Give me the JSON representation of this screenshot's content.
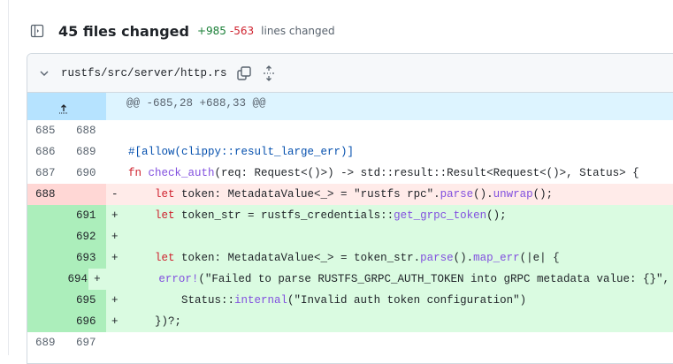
{
  "summary": {
    "files_changed": "45 files changed",
    "additions": "+985",
    "deletions": "-563",
    "lines_label": "lines changed"
  },
  "file": {
    "path": "rustfs/src/server/http.rs",
    "hunk_header": "@@ -685,28 +688,33 @@"
  },
  "icons": {
    "sidebar": "sidebar-toggle-icon",
    "chevron": "chevron-down-icon",
    "copy": "copy-icon",
    "expand": "unfold-icon",
    "expand_up": "expand-up-icon"
  },
  "colors": {
    "addition": "#1a7f37",
    "deletion": "#cf222e",
    "added_bg": "#dafbe1",
    "deleted_bg": "#ffebe9",
    "hunk_bg": "#ddf4ff"
  },
  "lines": [
    {
      "old": "685",
      "new": "688",
      "type": "ctx",
      "sign": "",
      "tokens": []
    },
    {
      "old": "686",
      "new": "689",
      "type": "ctx",
      "sign": "",
      "tokens": [
        [
          "#[allow(clippy::result_large_err)]",
          "a"
        ]
      ]
    },
    {
      "old": "687",
      "new": "690",
      "type": "ctx",
      "sign": "",
      "tokens": [
        [
          "fn",
          "k"
        ],
        [
          " ",
          ""
        ],
        [
          "check_auth",
          "f"
        ],
        [
          "(req: Request<()>) -> std::result::Result<Request<()>, Status> {",
          ""
        ]
      ]
    },
    {
      "old": "688",
      "new": "",
      "type": "del",
      "sign": "-",
      "tokens": [
        [
          "    ",
          ""
        ],
        [
          "let",
          "k"
        ],
        [
          " token: MetadataValue<_> = \"rustfs rpc\".",
          ""
        ],
        [
          "parse",
          "f"
        ],
        [
          "().",
          ""
        ],
        [
          "unwrap",
          "f"
        ],
        [
          "();",
          ""
        ]
      ]
    },
    {
      "old": "",
      "new": "691",
      "type": "add",
      "sign": "+",
      "tokens": [
        [
          "    ",
          ""
        ],
        [
          "let",
          "k"
        ],
        [
          " token_str = rustfs_credentials::",
          ""
        ],
        [
          "get_grpc_token",
          "f"
        ],
        [
          "();",
          ""
        ]
      ]
    },
    {
      "old": "",
      "new": "692",
      "type": "add",
      "sign": "+",
      "tokens": []
    },
    {
      "old": "",
      "new": "693",
      "type": "add",
      "sign": "+",
      "tokens": [
        [
          "    ",
          ""
        ],
        [
          "let",
          "k"
        ],
        [
          " token: MetadataValue<_> = token_str.",
          ""
        ],
        [
          "parse",
          "f"
        ],
        [
          "().",
          ""
        ],
        [
          "map_err",
          "f"
        ],
        [
          "(|e| {",
          ""
        ]
      ]
    },
    {
      "old": "",
      "new": "694",
      "type": "add",
      "sign": "+",
      "tokens": [
        [
          "        ",
          ""
        ],
        [
          "error!",
          "f"
        ],
        [
          "(\"Failed to parse RUSTFS_GRPC_AUTH_TOKEN into gRPC metadata value: {}\", e);",
          ""
        ]
      ]
    },
    {
      "old": "",
      "new": "695",
      "type": "add",
      "sign": "+",
      "tokens": [
        [
          "        Status::",
          ""
        ],
        [
          "internal",
          "f"
        ],
        [
          "(\"Invalid auth token configuration\")",
          ""
        ]
      ]
    },
    {
      "old": "",
      "new": "696",
      "type": "add",
      "sign": "+",
      "tokens": [
        [
          "    })?;",
          ""
        ]
      ]
    },
    {
      "old": "689",
      "new": "697",
      "type": "ctx",
      "sign": "",
      "tokens": []
    }
  ]
}
